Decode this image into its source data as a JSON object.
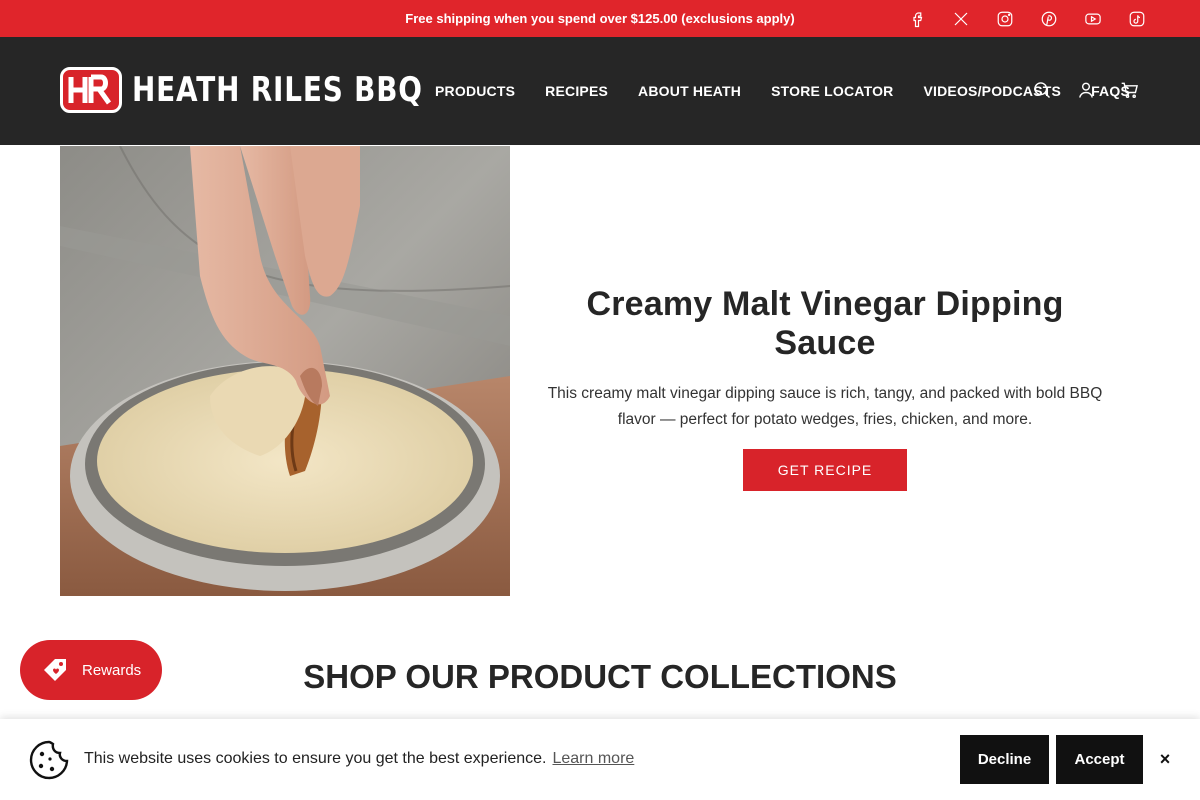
{
  "announcement": {
    "text": "Free shipping when you spend over $125.00 (exclusions apply)"
  },
  "social": [
    {
      "icon": "facebook-icon"
    },
    {
      "icon": "x-icon"
    },
    {
      "icon": "instagram-icon"
    },
    {
      "icon": "pinterest-icon"
    },
    {
      "icon": "youtube-icon"
    },
    {
      "icon": "tiktok-icon"
    }
  ],
  "header": {
    "logo_text": "HEATH RILES BBQ",
    "nav": [
      "PRODUCTS",
      "RECIPES",
      "ABOUT HEATH",
      "STORE LOCATOR",
      "VIDEOS/PODCASTS",
      "FAQS"
    ],
    "icons": [
      "search-icon",
      "account-icon",
      "cart-icon"
    ]
  },
  "hero": {
    "title": "Creamy Malt Vinegar Dipping Sauce",
    "description": "This creamy malt vinegar dipping sauce is rich, tangy, and packed with bold BBQ flavor — perfect for potato wedges, fries, chicken, and more.",
    "button": "GET RECIPE"
  },
  "collections": {
    "title": "SHOP OUR PRODUCT COLLECTIONS"
  },
  "rewards": {
    "label": "Rewards"
  },
  "cookie": {
    "message": "This website uses cookies to ensure you get the best experience.",
    "learn_more": "Learn more",
    "decline": "Decline",
    "accept": "Accept",
    "close": "×"
  },
  "colors": {
    "brand_red": "#e0252b",
    "header_dark": "#262626",
    "button_dark": "#111111"
  }
}
